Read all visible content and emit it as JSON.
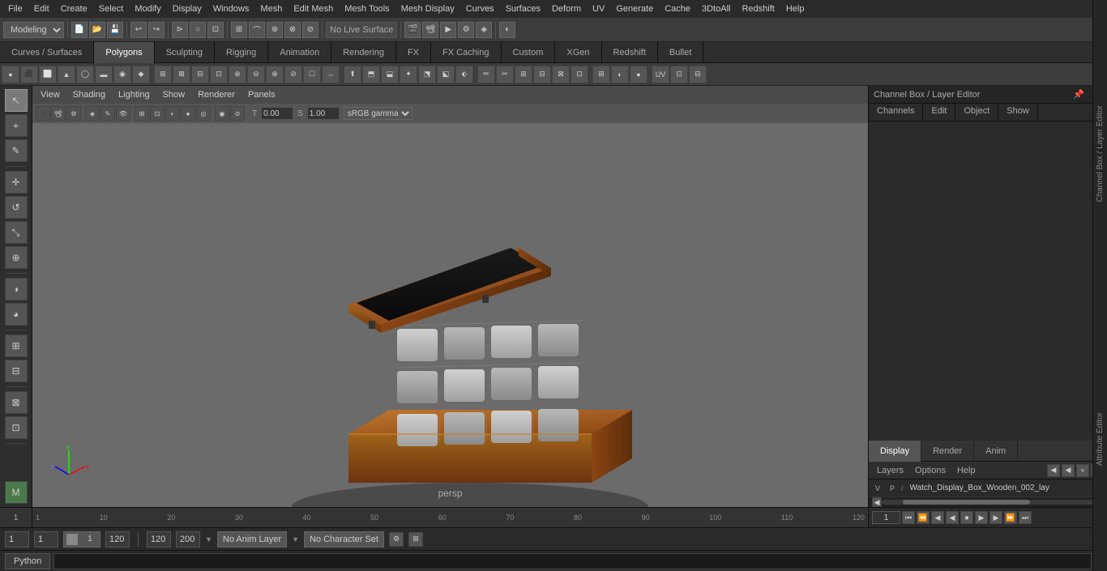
{
  "menubar": {
    "items": [
      "File",
      "Edit",
      "Create",
      "Select",
      "Modify",
      "Display",
      "Windows",
      "Mesh",
      "Edit Mesh",
      "Mesh Tools",
      "Mesh Display",
      "Curves",
      "Surfaces",
      "Deform",
      "UV",
      "Generate",
      "Cache",
      "3DtoAll",
      "Redshift",
      "Help"
    ]
  },
  "toolbar1": {
    "mode_label": "Modeling",
    "live_surface": "No Live Surface"
  },
  "tabs": {
    "curves_surfaces": "Curves / Surfaces",
    "polygons": "Polygons",
    "sculpting": "Sculpting",
    "rigging": "Rigging",
    "animation": "Animation",
    "rendering": "Rendering",
    "fx": "FX",
    "fx_caching": "FX Caching",
    "custom": "Custom",
    "xgen": "XGen",
    "redshift": "Redshift",
    "bullet": "Bullet"
  },
  "viewport": {
    "menus": [
      "View",
      "Shading",
      "Lighting",
      "Show",
      "Renderer",
      "Panels"
    ],
    "camera": "persp",
    "color_space": "sRGB gamma",
    "translate_value": "0.00",
    "scale_value": "1.00"
  },
  "rightpanel": {
    "title": "Channel Box / Layer Editor",
    "tabs": {
      "channels": "Channels",
      "edit": "Edit",
      "object": "Object",
      "show": "Show"
    },
    "display_tabs": [
      "Display",
      "Render",
      "Anim"
    ],
    "active_display_tab": "Display",
    "layers_toolbar": {
      "layers": "Layers",
      "options": "Options",
      "help": "Help"
    },
    "layer_row": {
      "v": "V",
      "p": "P",
      "name": "Watch_Display_Box_Wooden_002_lay"
    }
  },
  "timeline": {
    "start": "1",
    "end": "120",
    "current": "1",
    "marks": [
      "1",
      "10",
      "20",
      "30",
      "40",
      "50",
      "60",
      "70",
      "80",
      "90",
      "100",
      "110",
      "120"
    ]
  },
  "statusbar": {
    "field1": "1",
    "field2": "1",
    "field3": "1",
    "field4": "120",
    "range_start": "120",
    "range_end": "200",
    "anim_layer": "No Anim Layer",
    "char_set": "No Character Set"
  },
  "pythonbar": {
    "tab": "Python"
  },
  "side_labels": {
    "channel_box": "Channel Box / Layer Editor",
    "attribute_editor": "Attribute Editor"
  },
  "icons": {
    "select": "↖",
    "transform": "✛",
    "rotate": "↺",
    "scale": "⤡",
    "universal": "⊕",
    "lasso": "⌖",
    "paint": "✎",
    "snap": "⊞"
  }
}
